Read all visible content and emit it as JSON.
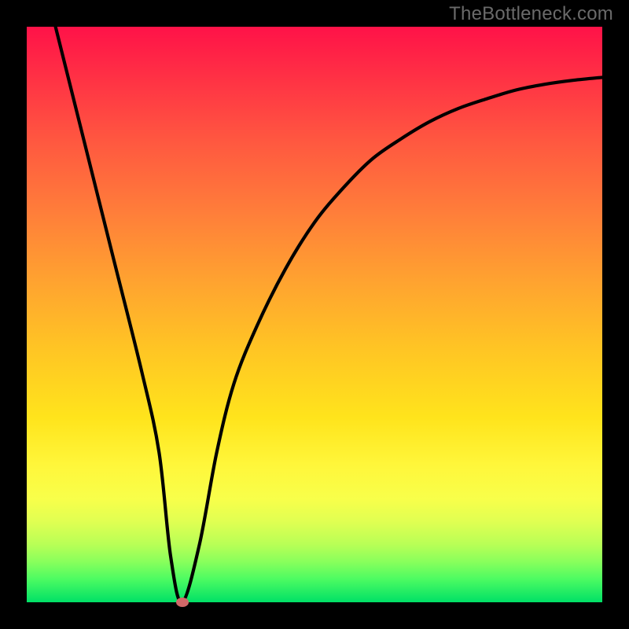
{
  "watermark": "TheBottleneck.com",
  "chart_data": {
    "type": "line",
    "title": "",
    "xlabel": "",
    "ylabel": "",
    "xlim": [
      0,
      100
    ],
    "ylim": [
      0,
      100
    ],
    "grid": false,
    "legend": false,
    "series": [
      {
        "name": "bottleneck-curve",
        "x": [
          5,
          10,
          15,
          20,
          23,
          25,
          27,
          30,
          33,
          36,
          40,
          45,
          50,
          55,
          60,
          65,
          70,
          75,
          80,
          85,
          90,
          95,
          100
        ],
        "y": [
          100,
          80,
          60,
          40,
          26,
          8,
          0,
          10,
          26,
          38,
          48,
          58,
          66,
          72,
          77,
          80.5,
          83.5,
          85.8,
          87.5,
          89,
          90,
          90.7,
          91.2
        ]
      }
    ],
    "marker": {
      "x": 27,
      "y": 0,
      "color": "#d06868"
    },
    "gradient_stops": [
      {
        "pos": 0,
        "color": "#ff1248"
      },
      {
        "pos": 50,
        "color": "#ffb02a"
      },
      {
        "pos": 80,
        "color": "#fff63a"
      },
      {
        "pos": 100,
        "color": "#00e066"
      }
    ]
  }
}
